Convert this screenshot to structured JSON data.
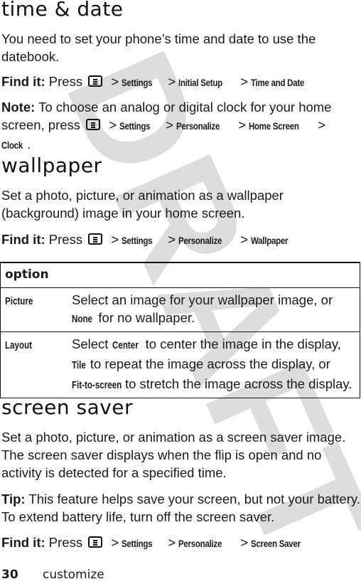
{
  "watermark": "DRAFT",
  "sections": {
    "time_date": {
      "title": "time & date",
      "intro": "You need to set your phone’s time and date to use the datebook.",
      "find_it": {
        "lead": "Find it:",
        "press": "Press",
        "path": [
          "Settings",
          "Initial Setup",
          "Time and Date"
        ]
      },
      "note": {
        "lead": "Note:",
        "text": "To choose an analog or digital clock for your home screen, press",
        "path": [
          "Settings",
          "Personalize",
          "Home Screen",
          "Clock"
        ],
        "end": "."
      }
    },
    "wallpaper": {
      "title": "wallpaper",
      "intro": "Set a photo, picture, or animation as a wallpaper (background) image in your home screen.",
      "find_it": {
        "lead": "Find it:",
        "press": "Press",
        "path": [
          "Settings",
          "Personalize",
          "Wallpaper"
        ]
      },
      "table": {
        "header": "option",
        "rows": [
          {
            "name": "Picture",
            "desc_before": "Select an image for your wallpaper image, or ",
            "keyword": "None",
            "desc_after": " for no wallpaper."
          },
          {
            "name": "Layout",
            "desc_a": "Select ",
            "kw1": "Center",
            "desc_b": " to center the image in the display, ",
            "kw2": "Tile",
            "desc_c": " to repeat the image across the display, or ",
            "kw3": "Fit-to-screen",
            "desc_d": " to stretch the image across the display."
          }
        ]
      }
    },
    "screen_saver": {
      "title": "screen saver",
      "intro": "Set a photo, picture, or animation as a screen saver image. The screen saver displays when the flip is open and no activity is detected for a specified time.",
      "tip": {
        "lead": "Tip:",
        "text": "This feature helps save your screen, but not your battery. To extend battery life, turn off the screen saver."
      },
      "find_it": {
        "lead": "Find it:",
        "press": "Press",
        "path": [
          "Settings",
          "Personalize",
          "Screen Saver"
        ]
      }
    }
  },
  "footer": {
    "page_number": "30",
    "section": "customize"
  },
  "separator": ">",
  "icons": {
    "menu_key": "menu-key-icon"
  }
}
